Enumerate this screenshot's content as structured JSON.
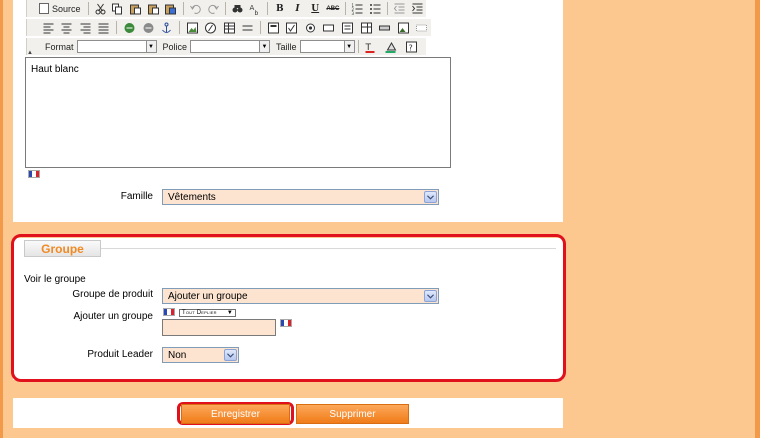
{
  "editor": {
    "toolbar": {
      "source_label": "Source",
      "format_label": "Format",
      "font_label": "Police",
      "size_label": "Taille"
    },
    "content": "Haut blanc"
  },
  "famille": {
    "label": "Famille",
    "value": "Vêtements"
  },
  "groupe": {
    "legend": "Groupe",
    "voir_label": "Voir le groupe",
    "groupe_produit_label": "Groupe de produit",
    "groupe_produit_value": "Ajouter un groupe",
    "ajouter_groupe_label": "Ajouter un groupe",
    "small_dropdown_value": "Tout Deplier",
    "produit_leader_label": "Produit Leader",
    "produit_leader_value": "Non"
  },
  "buttons": {
    "save": "Enregistrer",
    "delete": "Supprimer"
  },
  "colors": {
    "accent_orange": "#f08a25",
    "highlight_red": "#e0101c",
    "page_bg": "#fcc890"
  }
}
